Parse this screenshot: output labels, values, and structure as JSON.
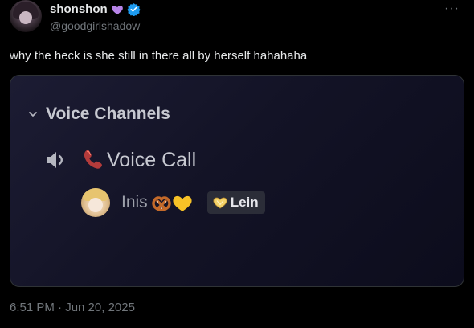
{
  "tweet": {
    "display_name": "shonshon",
    "handle": "@goodgirlshadow",
    "more": "···",
    "text": "why the heck is she still in there all by herself hahahaha",
    "timestamp": "6:51 PM · Jun 20, 2025"
  },
  "discord": {
    "category": "Voice Channels",
    "channel_name": "Voice Call",
    "member_name": "Inis",
    "tag_label": "Lein"
  },
  "icons": {
    "heart": "purple-heart-icon",
    "verified": "verified-badge-icon",
    "speaker": "speaker-icon",
    "phone": "telephone-receiver-icon",
    "pretzel": "pretzel-icon",
    "yellow_heart": "yellow-heart-icon"
  },
  "colors": {
    "verified_blue": "#1d9bf0",
    "heart_purple": "#b784e8",
    "card_bg": "#131326"
  }
}
